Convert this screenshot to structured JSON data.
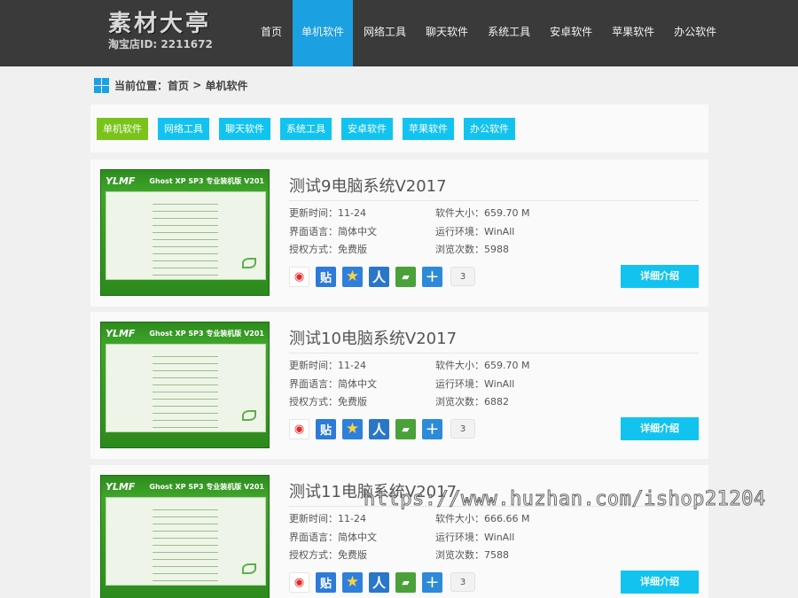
{
  "header": {
    "logo_main": "素材大亭",
    "logo_sub": "淘宝店ID: 2211672",
    "nav": [
      {
        "label": "首页"
      },
      {
        "label": "单机软件",
        "active": true
      },
      {
        "label": "网络工具"
      },
      {
        "label": "聊天软件"
      },
      {
        "label": "系统工具"
      },
      {
        "label": "安卓软件"
      },
      {
        "label": "苹果软件"
      },
      {
        "label": "办公软件"
      }
    ]
  },
  "breadcrumb": {
    "prefix": "当前位置：",
    "home": "首页",
    "separator": " > ",
    "current": "单机软件"
  },
  "filter_tags": [
    {
      "label": "单机软件",
      "active": true
    },
    {
      "label": "网络工具"
    },
    {
      "label": "聊天软件"
    },
    {
      "label": "系统工具"
    },
    {
      "label": "安卓软件"
    },
    {
      "label": "苹果软件"
    },
    {
      "label": "办公软件"
    }
  ],
  "thumbnail": {
    "logo": "YLMF",
    "title": "Ghost XP SP3 专业装机版 V201"
  },
  "labels": {
    "update_time": "更新时间：",
    "size": "软件大小：",
    "language": "界面语言：",
    "environment": "运行环境：",
    "license": "授权方式：",
    "views": "浏览次数：",
    "detail": "详细介绍"
  },
  "share_icons": [
    "weibo-icon",
    "tieba-icon",
    "qzone-icon",
    "renren-icon",
    "kaixin-icon",
    "more-share-icon"
  ],
  "share_glyphs": {
    "weibo": "◉",
    "tieba": "贴",
    "qzone": "★",
    "renren": "人",
    "kaixin": "▰",
    "more": "+"
  },
  "items": [
    {
      "title": "测试9电脑系统V2017",
      "update_time": "11-24",
      "size": "659.70 M",
      "language": "简体中文",
      "environment": "WinAll",
      "license": "免费版",
      "views": "5988",
      "share_count": "3"
    },
    {
      "title": "测试10电脑系统V2017",
      "update_time": "11-24",
      "size": "659.70 M",
      "language": "简体中文",
      "environment": "WinAll",
      "license": "免费版",
      "views": "6882",
      "share_count": "3"
    },
    {
      "title": "测试11电脑系统V2017",
      "update_time": "11-24",
      "size": "666.66 M",
      "language": "简体中文",
      "environment": "WinAll",
      "license": "免费版",
      "views": "7588",
      "share_count": "3"
    }
  ],
  "watermark": "https://www.huzhan.com/ishop21204",
  "colors": {
    "accent": "#1ba0e1",
    "tag": "#12c3f0",
    "tag_active": "#7ac31a",
    "header_bg": "#3a3a3a"
  }
}
